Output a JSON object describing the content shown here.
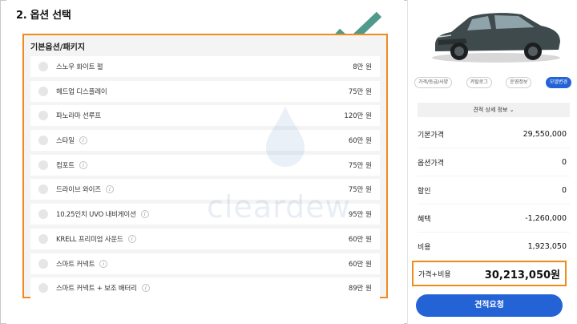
{
  "section": {
    "title": "2. 옵션 선택"
  },
  "package": {
    "header": "기본옵션/패키지",
    "items": [
      {
        "name": "스노우 화이트 펄",
        "price": "8만 원",
        "info": false
      },
      {
        "name": "헤드업 디스플레이",
        "price": "75만 원",
        "info": false
      },
      {
        "name": "파노라마 선루프",
        "price": "120만 원",
        "info": false
      },
      {
        "name": "스타일",
        "price": "60만 원",
        "info": true
      },
      {
        "name": "컴포트",
        "price": "75만 원",
        "info": true
      },
      {
        "name": "드라이브 와이즈",
        "price": "75만 원",
        "info": true
      },
      {
        "name": "10.25인치 UVO 내비게이션",
        "price": "95만 원",
        "info": true
      },
      {
        "name": "KRELL 프리미엄 사운드",
        "price": "60만 원",
        "info": true
      },
      {
        "name": "스마트 커넥트",
        "price": "60만 원",
        "info": true
      },
      {
        "name": "스마트 커넥트 + 보조 배터리",
        "price": "89만 원",
        "info": true
      }
    ]
  },
  "watermark": "cleardew",
  "tabs": [
    {
      "label": "가격/등급/사양",
      "active": false
    },
    {
      "label": "카탈로그",
      "active": false
    },
    {
      "label": "운영정보",
      "active": false
    },
    {
      "label": "모델변경",
      "active": true
    }
  ],
  "summary": {
    "detail_label": "견적 상세 정보 ⌄",
    "rows": [
      {
        "label": "기본가격",
        "value": "29,550,000"
      },
      {
        "label": "옵션가격",
        "value": "0"
      },
      {
        "label": "할인",
        "value": "0"
      },
      {
        "label": "혜택",
        "value": "-1,260,000"
      },
      {
        "label": "비용",
        "value": "1,923,050"
      }
    ],
    "total_label": "가격+비용",
    "total_value": "30,213,050원",
    "quote_button": "견적요청"
  },
  "colors": {
    "accent_blue": "#2463d6",
    "highlight_orange": "#f08b1e",
    "check_green": "#4f9a8a"
  },
  "icons": {
    "checkmark": "check-icon",
    "info": "info-icon",
    "chevron": "chevron-down-icon",
    "car": "car-image"
  }
}
